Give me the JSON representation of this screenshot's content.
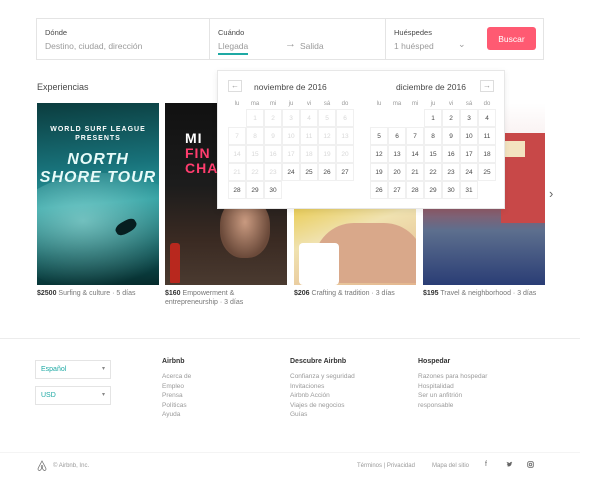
{
  "search": {
    "where_label": "Dónde",
    "where_placeholder": "Destino, ciudad, dirección",
    "when_label": "Cuándo",
    "arrival": "Llegada",
    "departure": "Salida",
    "guests_label": "Huéspedes",
    "guests_value": "1 huésped",
    "button": "Buscar",
    "accent_color": "#ff5a72"
  },
  "calendar": {
    "weekdays": [
      "lu",
      "ma",
      "mi",
      "ju",
      "vi",
      "sá",
      "do"
    ],
    "months": [
      {
        "title": "noviembre de 2016",
        "weeks": [
          [
            "",
            "1",
            "2",
            "3",
            "4",
            "5",
            "6"
          ],
          [
            "7",
            "8",
            "9",
            "10",
            "11",
            "12",
            "13"
          ],
          [
            "14",
            "15",
            "16",
            "17",
            "18",
            "19",
            "20"
          ],
          [
            "21",
            "22",
            "23",
            "24",
            "25",
            "26",
            "27"
          ],
          [
            "28",
            "29",
            "30",
            "",
            "",
            "",
            ""
          ]
        ],
        "first_available_day": 24
      },
      {
        "title": "diciembre de 2016",
        "weeks": [
          [
            "",
            "",
            "",
            "1",
            "2",
            "3",
            "4"
          ],
          [
            "5",
            "6",
            "7",
            "8",
            "9",
            "10",
            "11"
          ],
          [
            "12",
            "13",
            "14",
            "15",
            "16",
            "17",
            "18"
          ],
          [
            "19",
            "20",
            "21",
            "22",
            "23",
            "24",
            "25"
          ],
          [
            "26",
            "27",
            "28",
            "29",
            "30",
            "31",
            ""
          ]
        ],
        "first_available_day": 1
      }
    ]
  },
  "experiences": {
    "title": "Experiencias",
    "cards": [
      {
        "price": "$2500",
        "desc": "Surfing & culture · 5 días",
        "img_text_top": "WORLD SURF LEAGUE PRESENTS",
        "img_text_main": "NORTH SHORE TOUR"
      },
      {
        "price": "$160",
        "desc": "Empowerment & entrepreneurship · 3 días",
        "img_text": [
          "MI",
          "FIN",
          "CHA"
        ]
      },
      {
        "price": "$206",
        "desc": "Crafting & tradition · 3 días"
      },
      {
        "price": "$195",
        "desc": "Travel & neighborhood · 3 días"
      }
    ]
  },
  "footer": {
    "language": "Español",
    "currency": "USD",
    "columns": [
      {
        "heading": "Airbnb",
        "links": [
          "Acerca de",
          "Empleo",
          "Prensa",
          "Políticas",
          "Ayuda"
        ]
      },
      {
        "heading": "Descubre Airbnb",
        "links": [
          "Confianza y seguridad",
          "Invitaciones",
          "Airbnb Acción",
          "Viajes de negocios",
          "Guías"
        ]
      },
      {
        "heading": "Hospedar",
        "links": [
          "Razones para hospedar",
          "Hospitalidad",
          "Ser un anfitrión responsable"
        ]
      }
    ],
    "copyright": "© Airbnb, Inc.",
    "terms": "Términos | Privacidad",
    "sitemap": "Mapa del sitio",
    "social": [
      "f",
      "t",
      "i"
    ]
  }
}
